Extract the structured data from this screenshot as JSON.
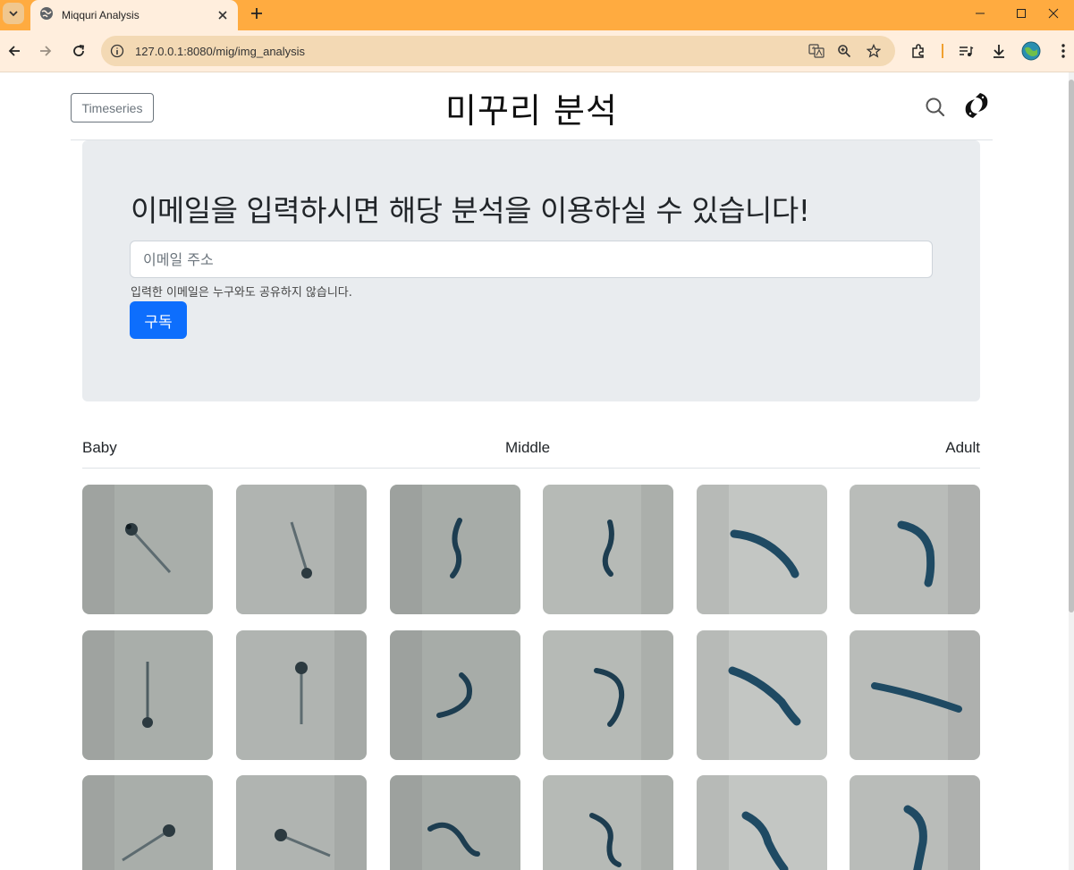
{
  "browser": {
    "tab_title": "Miqquri Analysis",
    "url": "127.0.0.1:8080/mig/img_analysis",
    "icons": [
      "tab-search-icon",
      "globe-icon",
      "close-icon",
      "plus-icon",
      "minimize-icon",
      "maximize-icon",
      "window-close-icon",
      "back-icon",
      "forward-icon",
      "reload-icon",
      "site-info-icon",
      "translate-icon",
      "zoom-icon",
      "star-icon",
      "extensions-icon",
      "media-icon",
      "download-icon",
      "profile-icon",
      "menu-icon"
    ],
    "colors": {
      "tabbar": "#ffab40",
      "toolbar": "#ffeedd",
      "omnibox": "#f3d9b4"
    }
  },
  "header": {
    "timeseries_label": "Timeseries",
    "title": "미꾸리 분석"
  },
  "subscribe": {
    "heading": "이메일을 입력하시면 해당 분석을 이용하실 수 있습니다!",
    "email_placeholder": "이메일 주소",
    "help_text": "입력한 이메일은 누구와도 공유하지 않습니다.",
    "button_label": "구독",
    "accent": "#0d6efd"
  },
  "stages": {
    "baby": "Baby",
    "middle": "Middle",
    "adult": "Adult"
  },
  "gallery": {
    "rows": [
      [
        "larva",
        "larva",
        "juvenile",
        "juvenile",
        "adult",
        "adult"
      ],
      [
        "larva",
        "larva",
        "juvenile",
        "juvenile",
        "adult",
        "adult"
      ],
      [
        "larva",
        "larva",
        "juvenile",
        "juvenile",
        "adult",
        "adult"
      ]
    ]
  }
}
